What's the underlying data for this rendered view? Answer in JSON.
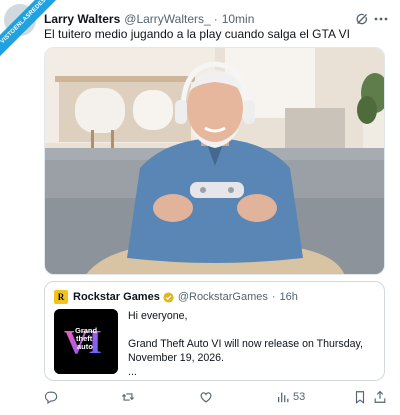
{
  "watermark": {
    "text": "VISTOENLASREDES"
  },
  "author": {
    "name": "Larry Walters",
    "handle": "@LarryWalters_",
    "separator": "·",
    "time": "10min"
  },
  "post": {
    "text": "El tuitero medio jugando a la play cuando salga el GTA VI"
  },
  "quote": {
    "logo_letter": "R",
    "name": "Rockstar Games",
    "handle": "@RockstarGames",
    "separator": "·",
    "time": "16h",
    "thumb_text": [
      "Grand",
      "theft",
      "auto"
    ],
    "thumb_roman": "VI",
    "lines": [
      "Hi everyone,",
      "",
      "Grand Theft Auto VI will now release on Thursday,",
      "November 19, 2026.",
      "..."
    ]
  },
  "actions": {
    "views_count": "53"
  },
  "icons": {
    "grok": "grok-icon",
    "more": "more-icon",
    "verified": "verified-badge-icon",
    "reply": "reply-icon",
    "repost": "repost-icon",
    "like": "like-icon",
    "views": "views-icon",
    "bookmark": "bookmark-icon",
    "share": "share-icon"
  },
  "colors": {
    "ribbon": "#1fa2df",
    "verified": "#e2b719",
    "text": "#0f1419",
    "muted": "#536471"
  }
}
